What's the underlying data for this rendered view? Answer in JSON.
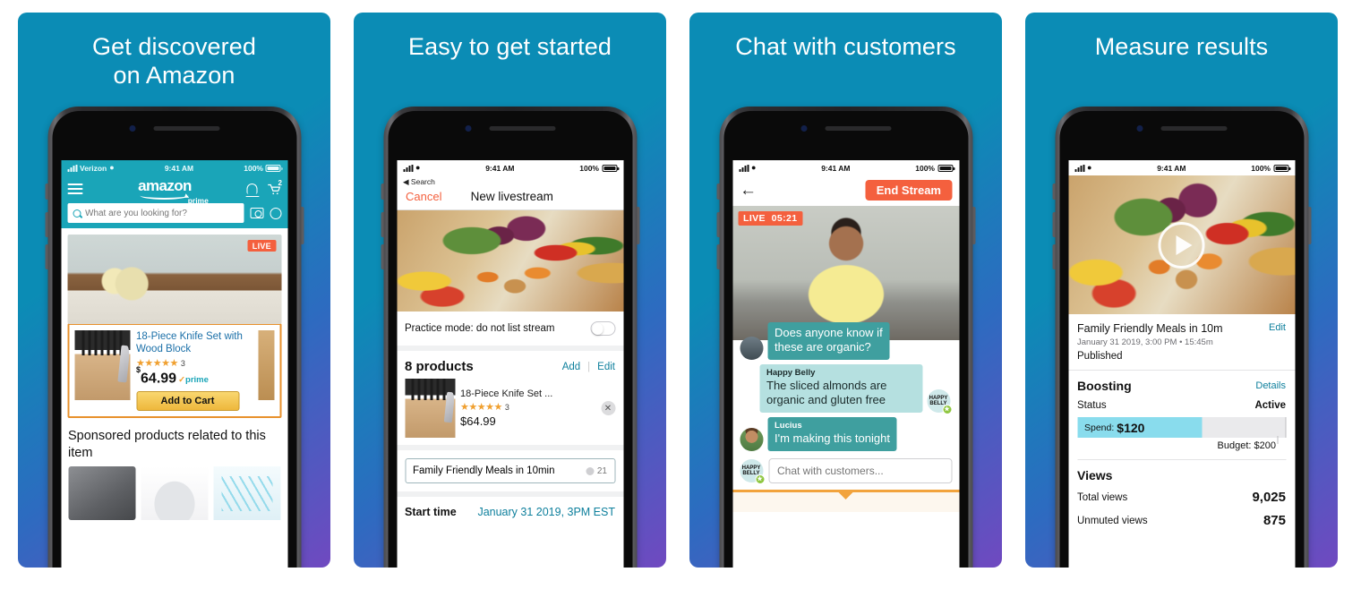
{
  "theme": {
    "brand_teal": "#0b8cb5",
    "brand_purple": "#7049c0",
    "amazon_nav_teal": "#1aa5b8",
    "accent_orange": "#f4603e",
    "link_teal": "#0d7f9c",
    "star_gold": "#f0a030",
    "progress_fill": "#89dced"
  },
  "panels": [
    {
      "headline": "Get discovered\non Amazon",
      "status_bar": {
        "carrier": "Verizon",
        "time": "9:41 AM",
        "battery": "100%"
      },
      "amazon": {
        "logo": "amazon",
        "logo_sub": "prime",
        "menu_icon": "hamburger-icon",
        "bell_icon": "bell-icon",
        "cart_icon": "cart-icon",
        "cart_count": "2",
        "search_placeholder": "What are you looking for?",
        "search_value": "",
        "camera_icon": "camera-icon",
        "voice_icon": "voice-circle-icon",
        "live_badge": "LIVE",
        "product": {
          "title": "18-Piece Knife Set with Wood Block",
          "stars": "★★★★★",
          "review_count": "3",
          "currency": "$",
          "price": "64.99",
          "prime_label": "prime",
          "add_to_cart": "Add to Cart"
        },
        "sponsored_heading": "Sponsored products related to this item"
      }
    },
    {
      "headline": "Easy to get started",
      "status_bar": {
        "carrier": "",
        "time": "9:41 AM",
        "battery": "100%"
      },
      "livestream": {
        "back_label": "Search",
        "cancel": "Cancel",
        "title": "New livestream",
        "practice_label": "Practice mode: do not list stream",
        "practice_on": false,
        "products_count": "8 products",
        "add_label": "Add",
        "edit_label": "Edit",
        "product": {
          "title": "18-Piece Knife Set ...",
          "stars": "★★★★★",
          "review_count": "3",
          "price": "$64.99",
          "remove_icon": "close-icon"
        },
        "stream_title_value": "Family Friendly Meals in 10min",
        "char_remaining": "21",
        "start_time_label": "Start time",
        "start_time_value": "January 31 2019, 3PM EST"
      }
    },
    {
      "headline": "Chat with customers",
      "status_bar": {
        "carrier": "",
        "time": "9:41 AM",
        "battery": "100%"
      },
      "broadcast": {
        "back_icon": "arrow-left-icon",
        "end_stream": "End Stream",
        "live_label": "LIVE",
        "elapsed": "05:21",
        "messages": [
          {
            "name": "",
            "text": "Does anyone know if\nthese are organic?",
            "style": "dark",
            "avatar": "viewer-avatar"
          },
          {
            "name": "Happy Belly",
            "text": "The sliced almonds are organic and gluten free",
            "style": "light",
            "avatar": "happy-belly-logo"
          },
          {
            "name": "Lucius",
            "text": "I'm making this tonight",
            "style": "dark",
            "avatar": "lucius-avatar"
          }
        ],
        "chat_placeholder": "Chat with customers...",
        "seller_avatar": "happy-belly-logo"
      }
    },
    {
      "headline": "Measure results",
      "status_bar": {
        "carrier": "",
        "time": "9:41 AM",
        "battery": "100%"
      },
      "metrics": {
        "play_icon": "play-icon",
        "title": "Family Friendly Meals in 10m",
        "edit_label": "Edit",
        "subtitle": "January 31 2019, 3:00 PM • 15:45m",
        "state": "Published",
        "boosting_heading": "Boosting",
        "details_link": "Details",
        "status_label": "Status",
        "status_value": "Active",
        "spend_label": "Spend:",
        "spend_value": "$120",
        "budget_label": "Budget: $200",
        "spend_percent": 60,
        "views_heading": "Views",
        "rows": [
          {
            "label": "Total views",
            "value": "9,025"
          },
          {
            "label": "Unmuted views",
            "value": "875"
          }
        ]
      }
    }
  ]
}
